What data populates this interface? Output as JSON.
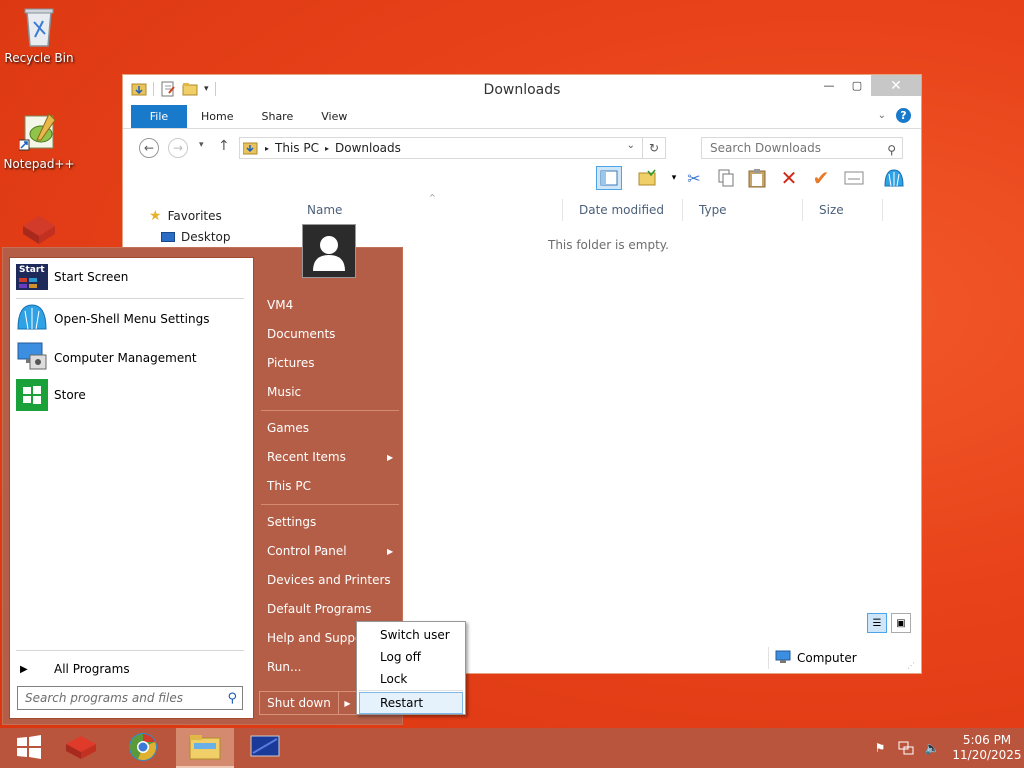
{
  "desktop": {
    "icons": [
      {
        "label": "Recycle Bin",
        "icon": "recycle-bin-icon"
      },
      {
        "label": "Notepad++",
        "icon": "notepad-plus-plus-icon"
      },
      {
        "label": "",
        "icon": "cube-app-icon"
      }
    ]
  },
  "explorer": {
    "title": "Downloads",
    "ribbon_tabs": [
      "File",
      "Home",
      "Share",
      "View"
    ],
    "address": {
      "segments": [
        "This PC",
        "Downloads"
      ]
    },
    "search": {
      "placeholder": "Search Downloads"
    },
    "nav_pane": {
      "favorites_label": "Favorites",
      "desktop_label": "Desktop"
    },
    "columns": [
      "Name",
      "Date modified",
      "Type",
      "Size"
    ],
    "empty_message": "This folder is empty.",
    "status": {
      "computer_label": "Computer"
    }
  },
  "start_menu": {
    "pinned": [
      {
        "label": "Start Screen",
        "icon": "start-screen-icon"
      },
      {
        "label": "Open-Shell Menu Settings",
        "icon": "shell-icon"
      },
      {
        "label": "Computer Management",
        "icon": "computer-management-icon"
      },
      {
        "label": "Store",
        "icon": "store-icon"
      }
    ],
    "all_programs_label": "All Programs",
    "search_placeholder": "Search programs and files",
    "right_items": {
      "user": "VM4",
      "documents": "Documents",
      "pictures": "Pictures",
      "music": "Music",
      "games": "Games",
      "recent_items": "Recent Items",
      "this_pc": "This PC",
      "settings": "Settings",
      "control_panel": "Control Panel",
      "devices_printers": "Devices and Printers",
      "default_programs": "Default Programs",
      "help_support": "Help and Support",
      "run": "Run..."
    },
    "shutdown_label": "Shut down",
    "shutdown_submenu": [
      "Switch user",
      "Log off",
      "Lock",
      "Restart"
    ],
    "highlighted_submenu_item": "Restart"
  },
  "taskbar": {
    "buttons": [
      "windows-start-icon",
      "cube-app-icon",
      "chrome-icon",
      "file-explorer-icon",
      "remote-desktop-icon"
    ],
    "active_button": "file-explorer-icon",
    "clock": {
      "time": "5:06 PM",
      "date": "11/20/2025"
    }
  },
  "colors": {
    "accent": "#1979ca",
    "start_menu_bg": "#b55e47",
    "taskbar_bg": "#b8553c"
  }
}
